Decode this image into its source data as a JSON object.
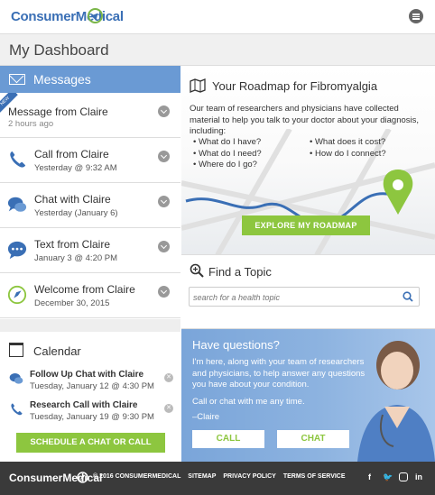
{
  "header": {
    "brand": "ConsumerMedical"
  },
  "page": {
    "title": "My Dashboard"
  },
  "messages": {
    "heading": "Messages",
    "new_badge": "NEW",
    "items": [
      {
        "title": "Message from Claire",
        "sub": "2 hours ago",
        "icon": "new-ribbon"
      },
      {
        "title": "Call from Claire",
        "sub": "Yesterday @ 9:32 AM",
        "icon": "phone-icon"
      },
      {
        "title": "Chat with Claire",
        "sub": "Yesterday (January 6)",
        "icon": "chat-bubbles-icon"
      },
      {
        "title": "Text from Claire",
        "sub": "January 3 @ 4:20 PM",
        "icon": "text-bubble-icon"
      },
      {
        "title": "Welcome from Claire",
        "sub": "December 30, 2015",
        "icon": "compass-icon"
      }
    ]
  },
  "calendar": {
    "heading": "Calendar",
    "items": [
      {
        "title": "Follow Up Chat with Claire",
        "sub": "Tuesday, January 12 @ 4:30 PM"
      },
      {
        "title": "Research Call with Claire",
        "sub": "Tuesday, January 19 @ 9:30 PM"
      }
    ],
    "schedule_label": "SCHEDULE A CHAT OR CALL"
  },
  "roadmap": {
    "title": "Your Roadmap for Fibromyalgia",
    "intro": "Our team of researchers and physicians have collected material to help you talk to your doctor about your diagnosis, including:",
    "list_left": [
      "What do I have?",
      "What do I need?",
      "Where do I go?"
    ],
    "list_right": [
      "What does it cost?",
      "How do I connect?"
    ],
    "button": "EXPLORE MY ROADMAP"
  },
  "topic": {
    "title": "Find a Topic",
    "placeholder": "search for a health topic"
  },
  "questions": {
    "title": "Have questions?",
    "text": "I'm here, along with your team of researchers and physicians, to help answer any questions you have about your condition.",
    "cta": "Call or chat with me any time.",
    "signature": "–Claire",
    "call_label": "CALL",
    "chat_label": "CHAT"
  },
  "footer": {
    "brand": "ConsumerMedical",
    "copyright": "© 2016 CONSUMERMEDICAL",
    "links": [
      "SITEMAP",
      "PRIVACY POLICY",
      "TERMS OF SERVICE"
    ],
    "social": [
      "f",
      "t",
      "ig",
      "in"
    ]
  },
  "colors": {
    "brand_blue": "#3a6fb5",
    "header_blue": "#6a9ad4",
    "green": "#8dc63f",
    "footer": "#3a3a3a"
  }
}
